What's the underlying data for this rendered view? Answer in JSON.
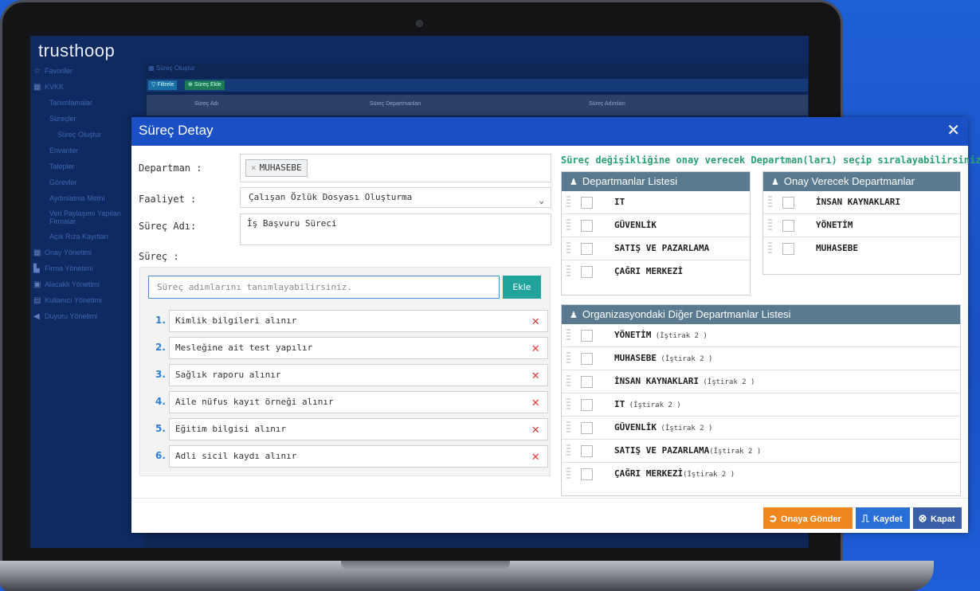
{
  "app": {
    "logo": "trusthoop"
  },
  "sidebar": {
    "items": [
      {
        "label": "Favoriler",
        "icon": "star-icon",
        "glyph": "☆",
        "level": 0
      },
      {
        "label": "KVKK",
        "icon": "grid-icon",
        "glyph": "▦",
        "level": 0
      },
      {
        "label": "Tanımlamalar",
        "level": 1
      },
      {
        "label": "Süreçler",
        "level": 1
      },
      {
        "label": "Süreç Oluştur",
        "level": 2
      },
      {
        "label": "Envanter",
        "level": 1
      },
      {
        "label": "Talepler",
        "level": 1
      },
      {
        "label": "Görevler",
        "level": 1
      },
      {
        "label": "Aydınlatma Metni",
        "level": 1
      },
      {
        "label": "Veri Paylaşımı Yapılan Firmalar",
        "level": 1
      },
      {
        "label": "Açık Rıza Kayıtları",
        "level": 1
      },
      {
        "label": "Onay Yönetimi",
        "icon": "grid-icon",
        "glyph": "▦",
        "level": 0
      },
      {
        "label": "Firma Yönetimi",
        "icon": "building-icon",
        "glyph": "▙",
        "level": 0
      },
      {
        "label": "Alacaklı Yönetimi",
        "icon": "calendar-icon",
        "glyph": "▣",
        "level": 0
      },
      {
        "label": "Kullanıcı Yönetimi",
        "icon": "card-icon",
        "glyph": "▤",
        "level": 0
      },
      {
        "label": "Duyuru Yönetimi",
        "icon": "megaphone-icon",
        "glyph": "◀",
        "level": 0
      }
    ]
  },
  "background_page": {
    "breadcrumb": "Süreç Oluştur",
    "filter_label": "Filtrele",
    "add_label": "Süreç Ekle",
    "columns": [
      "Süreç Adı",
      "Süreç Departmanları",
      "Süreç Adımları"
    ]
  },
  "modal": {
    "title": "Süreç Detay",
    "close_glyph": "✕",
    "department_label": "Departman :",
    "department_tag": "MUHASEBE",
    "tag_remove_glyph": "×",
    "activity_label": "Faaliyet :",
    "activity_value": "Çalışan Özlük Dosyası Oluşturma",
    "process_name_label": "Süreç Adı:",
    "process_name_value": "İş Başvuru Süreci",
    "process_label": "Süreç :",
    "step_placeholder": "Süreç adımlarını tanımlayabilirsiniz.",
    "add_button": "Ekle",
    "steps": [
      {
        "num": "1.",
        "text": "Kimlik bilgileri alınır"
      },
      {
        "num": "2.",
        "text": "Mesleğine ait test yapılır"
      },
      {
        "num": "3.",
        "text": "Sağlık raporu alınır"
      },
      {
        "num": "4.",
        "text": "Aile nüfus kayıt örneği alınır"
      },
      {
        "num": "5.",
        "text": "Eğitim bilgisi alınır"
      },
      {
        "num": "6.",
        "text": "Adli sicil kaydı alınır"
      }
    ],
    "hint": "Süreç değişikliğine onay verecek Departman(ları) seçip sıralayabilirsiniz.",
    "departments_list": {
      "title": "Departmanlar Listesi",
      "items": [
        "IT",
        "GÜVENLİK",
        "SATIŞ VE PAZARLAMA",
        "ÇAĞRI MERKEZİ"
      ]
    },
    "approver_list": {
      "title": "Onay Verecek Departmanlar",
      "items": [
        "İNSAN KAYNAKLARI",
        "YÖNETİM",
        "MUHASEBE"
      ]
    },
    "other_list": {
      "title": "Organizasyondaki Diğer Departmanlar Listesi",
      "items": [
        {
          "name": "YÖNETİM",
          "sub": " (İştirak 2 )"
        },
        {
          "name": "MUHASEBE",
          "sub": " (İştirak 2 )"
        },
        {
          "name": "İNSAN KAYNAKLARI",
          "sub": " (İştirak 2 )"
        },
        {
          "name": "IT",
          "sub": " (İştirak 2 )"
        },
        {
          "name": "GÜVENLİK",
          "sub": " (İştirak 2 )"
        },
        {
          "name": "SATIŞ VE PAZARLAMA",
          "sub": "(İştirak 2 )"
        },
        {
          "name": "ÇAĞRI MERKEZİ",
          "sub": "(İştirak 2 )"
        }
      ]
    },
    "footer": {
      "send_label": "Onaya Gönder",
      "save_label": "Kaydet",
      "close_label": "Kapat"
    },
    "colors": {
      "header": "#1a50c4",
      "send": "#f0861e",
      "save": "#2a6fd6",
      "close": "#3a5ea8",
      "hint": "#28a070",
      "delete": "#e03a3a",
      "add": "#1fa39a"
    }
  }
}
